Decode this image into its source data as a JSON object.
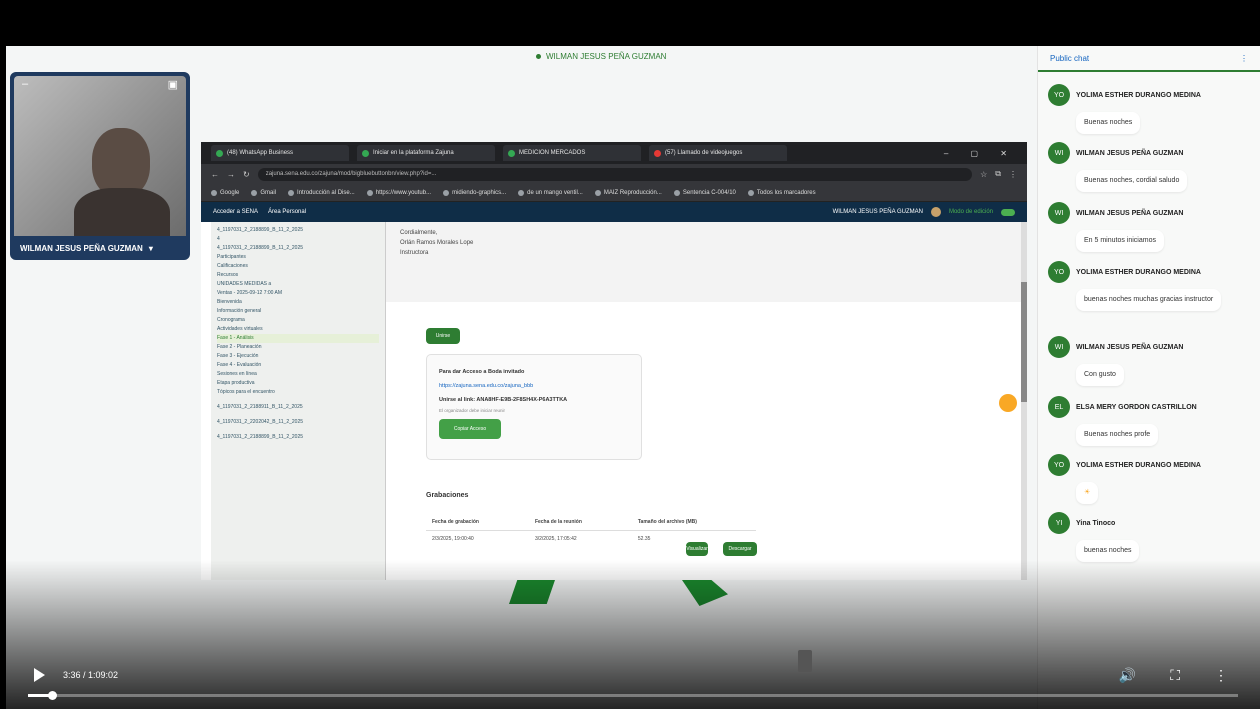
{
  "presenter": {
    "top_name": "WILMAN JESUS PEÑA GUZMAN",
    "webcam_name": "WILMAN JESUS PEÑA GUZMAN"
  },
  "browser": {
    "tabs": [
      "(48) WhatsApp Business",
      "Iniciar en la plataforma Zajuna",
      "MEDICION MERCADOS",
      "(57) Llamado de videojuegos"
    ],
    "url": "zajuna.sena.edu.co/zajuna/mod/bigbluebuttonbn/view.php?id=...",
    "bookmarks": [
      "Google",
      "Gmail",
      "Introducción al Dise...",
      "https://www.youtub...",
      "midiendo-graphics...",
      "de un mango ventil...",
      "MAIZ Reproducción...",
      "Sentencia C-004/10",
      "Todos los marcadores"
    ]
  },
  "lms": {
    "left_links": [
      "Acceder a SENA",
      "Área Personal"
    ],
    "user": "WILMAN JESUS PEÑA GUZMAN",
    "right_text": "Modo de edición"
  },
  "sidebar": {
    "items": [
      "4_1197031_2_2188899_B_11_2_2025",
      "4",
      "4_1197031_2_2188899_B_11_2_2025",
      "Participantes",
      "Calificaciones",
      "Recursos",
      "UNIDADES MEDIDAS a",
      "Ventas - 2025-09-12 7:00 AM",
      "Bienvenida",
      "Información general",
      "Cronograma",
      "Actividades virtuales",
      "Fase 1 - Análisis",
      "Fase 2 - Planeación",
      "Fase 3 - Ejecución",
      "Fase 4 - Evaluación",
      "Sesiones en línea",
      "Etapa productiva",
      "Tópicos para el encuentro",
      "4_1197031_2_2188911_B_11_2_2025",
      "4_1197031_2_2202042_B_11_2_2025",
      "4_1197031_2_2188899_B_11_2_2025"
    ]
  },
  "main": {
    "top_lines": [
      "Cordialmente,",
      "Orlán Ramos Morales Lope",
      "Instructora"
    ],
    "unirse_button": "Unirse",
    "card": {
      "title": "Para dar Acceso a Boda invitado",
      "link": "https://zajuna.sena.edu.co/zajuna_bbb",
      "line": "Unirse al link: ANA8HF-E9B-2F8SH4X-P6A3TTKA",
      "small": "El organizador debe iniciar reunir",
      "button": "Copiar Acceso"
    },
    "recordings_title": "Grabaciones",
    "table_headers": [
      "Fecha de grabación",
      "Fecha de la reunión",
      "Tamaño del archivo (MB)"
    ],
    "table_row": [
      "2/3/2025, 19:00:40",
      "3/2/2025, 17:05:42",
      "52.35"
    ],
    "row_buttons": [
      "Visualizar",
      "Descargar"
    ]
  },
  "chat": {
    "title": "Public chat",
    "messages": [
      {
        "initials": "YO",
        "name": "YOLIMA ESTHER DURANGO MEDINA",
        "text": "Buenas noches"
      },
      {
        "initials": "WI",
        "name": "WILMAN JESUS PEÑA GUZMAN",
        "text": "Buenas noches, cordial saludo"
      },
      {
        "initials": "WI",
        "name": "WILMAN JESUS PEÑA GUZMAN",
        "text": "En 5 minutos iniciamos"
      },
      {
        "initials": "YO",
        "name": "YOLIMA ESTHER DURANGO MEDINA",
        "text": "buenas noches muchas gracias instructor"
      },
      {
        "initials": "WI",
        "name": "WILMAN JESUS PEÑA GUZMAN",
        "text": "Con gusto"
      },
      {
        "initials": "EL",
        "name": "ELSA MERY GORDON CASTRILLON",
        "text": "Buenas noches profe"
      },
      {
        "initials": "YO",
        "name": "YOLIMA ESTHER DURANGO MEDINA",
        "text": "☀"
      },
      {
        "initials": "YI",
        "name": "Yina Tinoco",
        "text": "buenas noches"
      }
    ]
  },
  "player": {
    "time": "3:36 / 1:09:02",
    "progress": 0.02
  }
}
